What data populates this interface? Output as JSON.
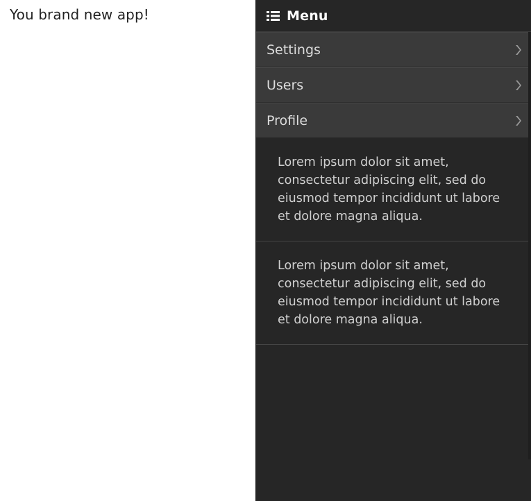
{
  "main": {
    "text": "You brand new app!"
  },
  "panel": {
    "title": "Menu",
    "icon": "list-icon",
    "items": [
      {
        "label": "Settings",
        "icon": "chevron-right-icon"
      },
      {
        "label": "Users",
        "icon": "chevron-right-icon"
      },
      {
        "label": "Profile",
        "icon": "chevron-right-icon"
      }
    ],
    "paragraphs": [
      "Lorem ipsum dolor sit amet, consectetur adipiscing elit, sed do eiusmod tempor incididunt ut labore et dolore magna aliqua.",
      "Lorem ipsum dolor sit amet, consectetur adipiscing elit, sed do eiusmod tempor incididunt ut labore et dolore magna aliqua."
    ]
  },
  "colors": {
    "panel_background": "#262626",
    "menu_item_background": "#3a3a3a",
    "panel_text": "#dcdcdc",
    "main_background": "#ffffff"
  }
}
